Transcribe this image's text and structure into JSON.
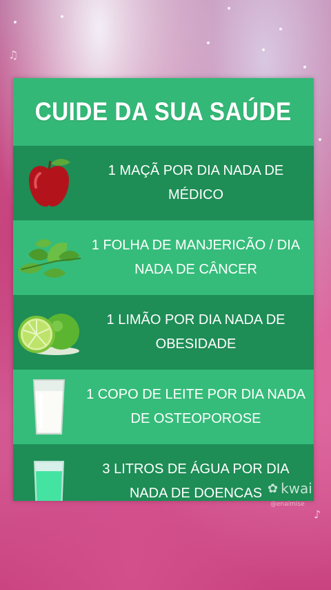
{
  "card": {
    "title": "CUIDE DA SUA SAÚDE",
    "colors": {
      "dark_row": "#1e8d56",
      "light_row": "#35bc7a",
      "title_bar": "#34b877",
      "text": "#ffffff"
    },
    "rows": [
      {
        "icon": "apple-icon",
        "line1": "1 MAÇÃ POR DIA NADA DE",
        "line2": "MÉDICO"
      },
      {
        "icon": "basil-leaves-icon",
        "line1": "1 FOLHA DE MANJERICÃO / DIA",
        "line2": "NADA DE CÂNCER"
      },
      {
        "icon": "lime-icon",
        "line1": "1 LIMÃO POR DIA NADA DE",
        "line2": "OBESIDADE"
      },
      {
        "icon": "milk-glass-icon",
        "line1": "1 COPO DE LEITE POR DIA NADA",
        "line2": "DE OSTEOPOROSE"
      },
      {
        "icon": "water-glass-icon",
        "line1": "3 LITROS DE ÁGUA POR DIA",
        "line2": "NADA DE DOENCAS"
      }
    ]
  },
  "watermark": {
    "brand": "kwai",
    "handle": "@enaimise"
  }
}
